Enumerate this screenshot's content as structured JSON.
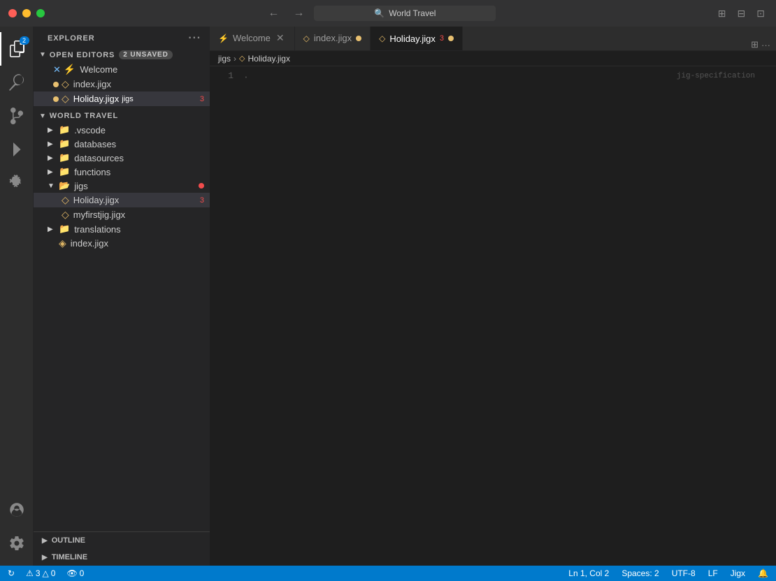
{
  "titleBar": {
    "searchPlaceholder": "World Travel",
    "navBack": "←",
    "navForward": "→"
  },
  "activityBar": {
    "icons": [
      {
        "name": "explorer-icon",
        "label": "Explorer",
        "active": true,
        "badge": "2"
      },
      {
        "name": "search-icon",
        "label": "Search",
        "active": false
      },
      {
        "name": "source-control-icon",
        "label": "Source Control",
        "active": false
      },
      {
        "name": "run-icon",
        "label": "Run",
        "active": false
      },
      {
        "name": "extensions-icon",
        "label": "Extensions",
        "active": false
      }
    ],
    "bottomIcons": [
      {
        "name": "account-icon",
        "label": "Account"
      },
      {
        "name": "settings-icon",
        "label": "Settings"
      }
    ]
  },
  "sidebar": {
    "title": "EXPLORER",
    "openEditors": {
      "label": "OPEN EDITORS",
      "badge": "2 unsaved",
      "files": [
        {
          "name": "Welcome",
          "icon": "welcome",
          "modified": false,
          "dotColor": "blue"
        },
        {
          "name": "index.jigx",
          "icon": "jig",
          "modified": true,
          "dotColor": "yellow"
        },
        {
          "name": "Holiday.jigx",
          "icon": "jig",
          "modified": true,
          "dotColor": "yellow",
          "badge": "3",
          "active": true
        }
      ]
    },
    "projectRoot": "WORLD TRAVEL",
    "tree": [
      {
        "name": ".vscode",
        "type": "folder",
        "indent": 0,
        "open": false
      },
      {
        "name": "databases",
        "type": "folder",
        "indent": 0,
        "open": false
      },
      {
        "name": "datasources",
        "type": "folder",
        "indent": 0,
        "open": false
      },
      {
        "name": "functions",
        "type": "folder",
        "indent": 0,
        "open": false
      },
      {
        "name": "jigs",
        "type": "folder",
        "indent": 0,
        "open": true,
        "hasDot": true
      },
      {
        "name": "Holiday.jigx",
        "type": "jig-file",
        "indent": 1,
        "active": true,
        "badge": "3"
      },
      {
        "name": "myfirstjig.jigx",
        "type": "jig-file",
        "indent": 1
      },
      {
        "name": "translations",
        "type": "folder",
        "indent": 0,
        "open": false
      },
      {
        "name": "index.jigx",
        "type": "index-file",
        "indent": 0
      }
    ],
    "outline": "OUTLINE",
    "timeline": "TIMELINE"
  },
  "tabs": [
    {
      "label": "Welcome",
      "icon": "welcome",
      "active": false,
      "modified": false
    },
    {
      "label": "index.jigx",
      "icon": "jig",
      "active": false,
      "modified": true
    },
    {
      "label": "Holiday.jigx",
      "icon": "jig",
      "active": true,
      "modified": true,
      "badge": "3"
    }
  ],
  "breadcrumb": {
    "root": "jigs",
    "separator": ">",
    "current": "Holiday.jigx"
  },
  "editor": {
    "lineNumbers": [
      "1"
    ],
    "codeHint": "jig-specification",
    "line1": "·"
  },
  "statusBar": {
    "errors": "3",
    "warnings": "0",
    "watches": "0",
    "position": "Ln 1, Col 2",
    "spaces": "Spaces: 2",
    "encoding": "UTF-8",
    "lineEnding": "LF",
    "language": "Jigx",
    "sync": "↻"
  }
}
